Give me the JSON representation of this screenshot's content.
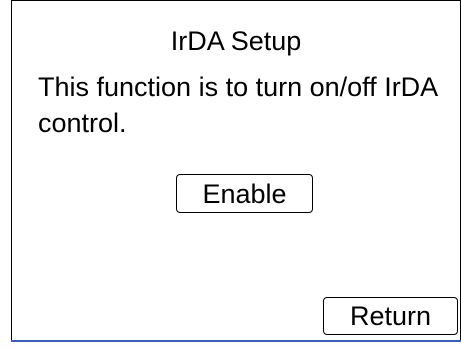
{
  "dialog": {
    "title": "IrDA Setup",
    "message": "This function is to turn on/off IrDA control.",
    "enable_label": "Enable",
    "return_label": "Return"
  },
  "colors": {
    "background": "#ffffff",
    "text": "#000000",
    "bottom_accent": "#3a5bd0"
  }
}
